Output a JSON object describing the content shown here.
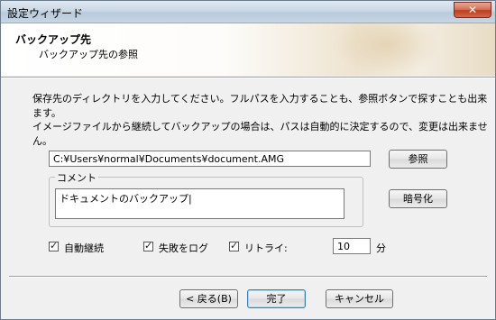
{
  "window": {
    "title": "設定ウィザード",
    "close_symbol": "✕"
  },
  "header": {
    "title": "バックアップ先",
    "subtitle": "バックアップ先の参照"
  },
  "instructions": {
    "line1": "保存先のディレクトリを入力してください。フルパスを入力することも、参照ボタンで探すことも出来ます。",
    "line2": "イメージファイルから継続してバックアップの場合は、パスは自動的に決定するので、変更は出来ません。"
  },
  "path": {
    "value": "C:¥Users¥normal¥Documents¥document.AMG",
    "browse_label": "参照"
  },
  "comment": {
    "label": "コメント",
    "value": "ドキュメントのバックアップ|"
  },
  "encrypt_label": "暗号化",
  "options": {
    "auto_continue": {
      "label": "自動継続",
      "checked": true
    },
    "log_failure": {
      "label": "失敗をログ",
      "checked": true
    },
    "retry": {
      "label": "リトライ:",
      "checked": true
    },
    "retry_value": "10",
    "retry_unit": "分"
  },
  "check_mark": "✓",
  "buttons": {
    "back": "< 戻る(B)",
    "finish": "完了",
    "cancel": "キャンセル"
  }
}
